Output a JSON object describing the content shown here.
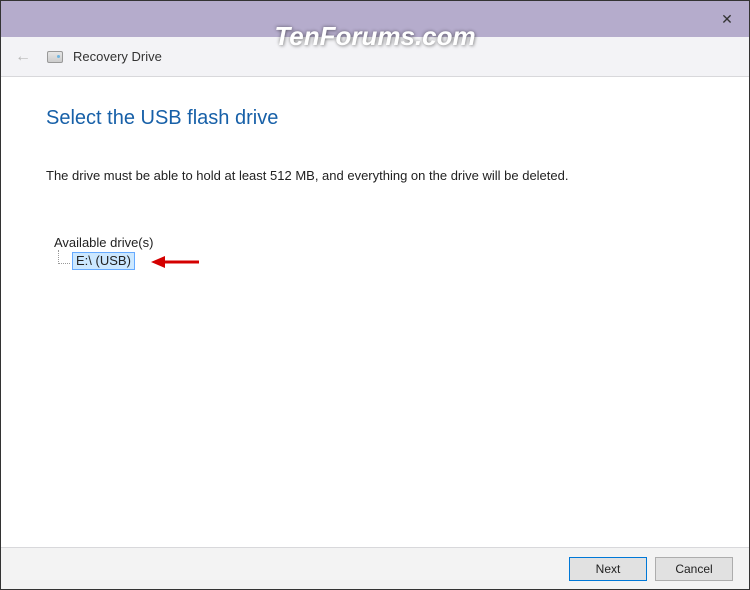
{
  "titlebar": {
    "close_symbol": "✕"
  },
  "header": {
    "back_symbol": "←",
    "title": "Recovery Drive"
  },
  "main": {
    "page_title": "Select the USB flash drive",
    "instruction": "The drive must be able to hold at least 512 MB, and everything on the drive will be deleted.",
    "available_label": "Available drive(s)",
    "drives": [
      {
        "label": "E:\\ (USB)",
        "selected": true
      }
    ]
  },
  "footer": {
    "next_label": "Next",
    "cancel_label": "Cancel"
  },
  "watermark": "TenForums.com"
}
